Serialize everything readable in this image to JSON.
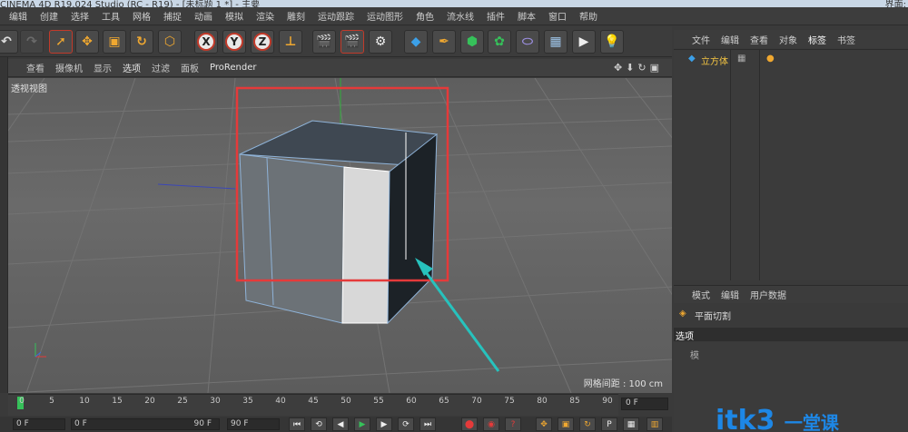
{
  "window": {
    "title": "CINEMA 4D R19.024 Studio (RC - R19) - [未标题 1 *] - 主要",
    "right_label": "界面:"
  },
  "menubar": [
    "编辑",
    "创建",
    "选择",
    "工具",
    "网格",
    "捕捉",
    "动画",
    "模拟",
    "渲染",
    "雕刻",
    "运动跟踪",
    "运动图形",
    "角色",
    "流水线",
    "插件",
    "脚本",
    "窗口",
    "帮助"
  ],
  "toolbar": {
    "axis_x": "X",
    "axis_y": "Y",
    "axis_z": "Z"
  },
  "viewport": {
    "menu": [
      "查看",
      "摄像机",
      "显示",
      "选项",
      "过滤",
      "面板",
      "ProRender"
    ],
    "label": "透视视图",
    "grid_info": "网格间距 : 100 cm"
  },
  "object_manager": {
    "menu": [
      "文件",
      "编辑",
      "查看",
      "对象",
      "标签",
      "书签"
    ],
    "object_name": "立方体"
  },
  "attribute_manager": {
    "menu": [
      "模式",
      "编辑",
      "用户数据"
    ],
    "tool_title": "平面切割",
    "tab": "选项",
    "field_label": "模"
  },
  "timeline": {
    "ticks": [
      "0",
      "5",
      "10",
      "15",
      "20",
      "25",
      "30",
      "35",
      "40",
      "45",
      "50",
      "55",
      "60",
      "65",
      "70",
      "75",
      "80",
      "85",
      "90"
    ],
    "current_frame": "0 F"
  },
  "bottom": {
    "start": "0 F",
    "range_start": "0 F",
    "range_end": "90 F",
    "end": "90 F"
  },
  "watermark": {
    "text": "itk3",
    "sub": "一堂课"
  }
}
